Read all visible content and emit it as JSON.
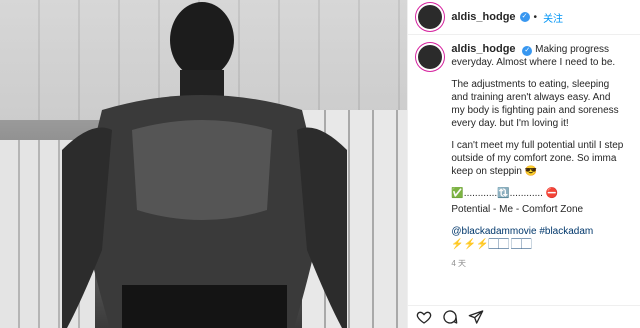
{
  "header": {
    "username": "aldis_hodge",
    "follow_label": "关注"
  },
  "caption": {
    "username": "aldis_hodge",
    "para1": "Making progress everyday. Almost where I need to be.",
    "para2": "The adjustments to eating, sleeping and training aren't always easy. And my body is fighting pain and soreness every day. but I'm loving it!",
    "para3": "I can't meet my full potential until I step outside of my comfort zone. So imma keep on steppin 😎",
    "para4": "✅............🔃............ ⛔",
    "para5": "Potential - Me - Comfort Zone",
    "hashtags": "@blackadammovie #blackadam ⚡⚡⚡🏻🏻 🏻🏻",
    "time": "4 天"
  },
  "icons": [
    "verified-icon",
    "heart-icon",
    "comment-icon",
    "share-icon"
  ]
}
